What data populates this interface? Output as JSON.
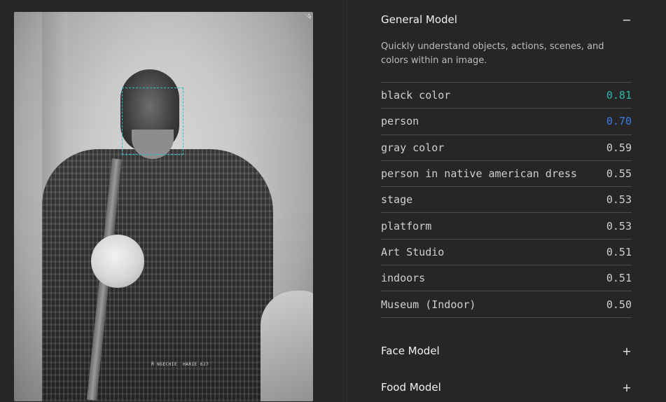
{
  "image": {
    "caption_text": "M̂ NGECHIE  HARIE  627",
    "corner_text": "..TA"
  },
  "panel": {
    "sections": [
      {
        "title": "General Model",
        "toggle": "−",
        "description": "Quickly understand objects, actions, scenes, and colors within an image."
      },
      {
        "title": "Face Model",
        "toggle": "+"
      },
      {
        "title": "Food Model",
        "toggle": "+"
      }
    ],
    "results": [
      {
        "label": "black color",
        "score": "0.81",
        "color": "#2ab7a9"
      },
      {
        "label": "person",
        "score": "0.70",
        "color": "#3d7be6"
      },
      {
        "label": "gray color",
        "score": "0.59"
      },
      {
        "label": "person in native american dress",
        "score": "0.55"
      },
      {
        "label": "stage",
        "score": "0.53"
      },
      {
        "label": "platform",
        "score": "0.53"
      },
      {
        "label": "Art Studio",
        "score": "0.51"
      },
      {
        "label": "indoors",
        "score": "0.51"
      },
      {
        "label": "Museum (Indoor)",
        "score": "0.50"
      }
    ]
  },
  "colors": {
    "background": "#262626",
    "detection_box": "#2ac6c6",
    "text": "#f2f2f2"
  }
}
